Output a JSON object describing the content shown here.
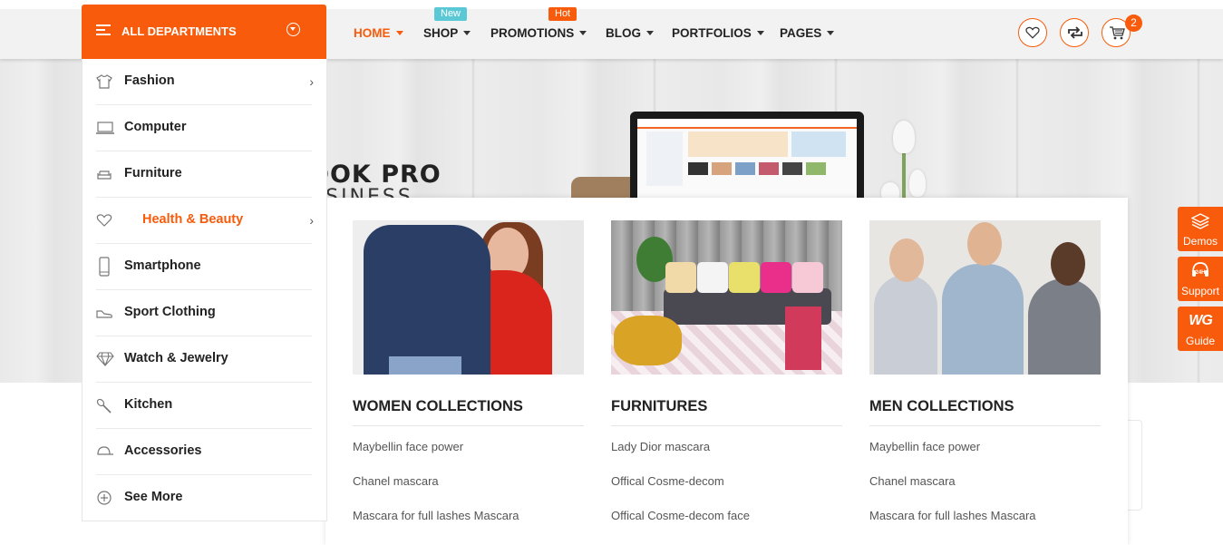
{
  "departments": {
    "title": "ALL DEPARTMENTS",
    "items": [
      {
        "label": "Fashion",
        "icon": "shirt-icon",
        "has_submenu": true,
        "active": false
      },
      {
        "label": "Computer",
        "icon": "laptop-icon",
        "has_submenu": false,
        "active": false
      },
      {
        "label": "Furniture",
        "icon": "sofa-icon",
        "has_submenu": false,
        "active": false
      },
      {
        "label": "Health & Beauty",
        "icon": "heart-icon",
        "has_submenu": true,
        "active": true
      },
      {
        "label": "Smartphone",
        "icon": "smartphone-icon",
        "has_submenu": false,
        "active": false
      },
      {
        "label": "Sport Clothing",
        "icon": "shoe-icon",
        "has_submenu": false,
        "active": false
      },
      {
        "label": "Watch & Jewelry",
        "icon": "diamond-icon",
        "has_submenu": false,
        "active": false
      },
      {
        "label": "Kitchen",
        "icon": "spoon-icon",
        "has_submenu": false,
        "active": false
      },
      {
        "label": "Accessories",
        "icon": "cap-icon",
        "has_submenu": false,
        "active": false
      },
      {
        "label": "See More",
        "icon": "plus-circle-icon",
        "has_submenu": false,
        "active": false
      }
    ]
  },
  "nav": {
    "items": [
      {
        "label": "HOME",
        "active": true
      },
      {
        "label": "SHOP",
        "badge": "New"
      },
      {
        "label": "PROMOTIONS",
        "badge": "Hot"
      },
      {
        "label": "BLOG"
      },
      {
        "label": "PORTFOLIOS"
      },
      {
        "label": "PAGES"
      }
    ]
  },
  "header_actions": {
    "wishlist_icon": "heart-icon",
    "compare_icon": "repeat-icon",
    "cart_icon": "cart-icon",
    "cart_count": "2"
  },
  "hero": {
    "title": "OOK PRO",
    "subtitle": "USINESS"
  },
  "mega_menu": {
    "columns": [
      {
        "title": "WOMEN COLLECTIONS",
        "links": [
          "Maybellin face power",
          "Chanel mascara",
          "Mascara for full lashes Mascara"
        ]
      },
      {
        "title": "FURNITURES",
        "links": [
          "Lady Dior mascara",
          "Offical Cosme-decom",
          "Offical Cosme-decom face"
        ]
      },
      {
        "title": "MEN COLLECTIONS",
        "links": [
          "Maybellin face power",
          "Chanel mascara",
          "Mascara for full lashes Mascara"
        ]
      }
    ]
  },
  "side_widget": {
    "items": [
      {
        "label": "Demos",
        "icon": "layers-icon"
      },
      {
        "label": "Support",
        "icon": "headset-24h-icon",
        "icon_text": "24H"
      },
      {
        "label": "Guide",
        "icon": "wg-logo-icon",
        "icon_text": "WG"
      }
    ]
  },
  "colors": {
    "accent": "#f75b0b",
    "badge_new": "#5bc8d6",
    "header_bg": "#f2f2f2"
  }
}
